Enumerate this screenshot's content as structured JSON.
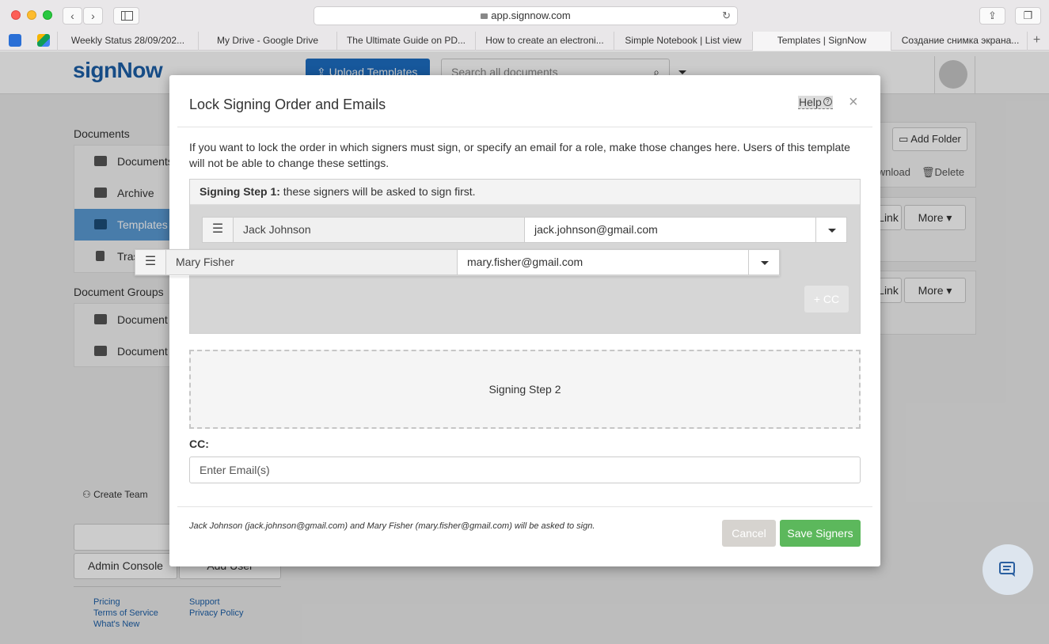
{
  "browser": {
    "url": "app.signnow.com",
    "tabs": [
      {
        "label": "Weekly Status 28/09/202...",
        "active": false
      },
      {
        "label": "My Drive - Google Drive",
        "active": false
      },
      {
        "label": "The Ultimate Guide on PD...",
        "active": false
      },
      {
        "label": "How to create an electroni...",
        "active": false
      },
      {
        "label": "Simple Notebook | List view",
        "active": false
      },
      {
        "label": "Templates | SignNow",
        "active": true
      },
      {
        "label": "Создание снимка экрана...",
        "active": false
      }
    ],
    "plus_label": "+"
  },
  "app": {
    "logo": "signNow",
    "upload_label": "Upload Templates",
    "search_placeholder": "Search all documents",
    "documents_heading": "Documents",
    "doc_items": [
      {
        "label": "Documents"
      },
      {
        "label": "Archive"
      },
      {
        "label": "Templates"
      },
      {
        "label": "Trash"
      }
    ],
    "groups_heading": "Document Groups",
    "group_items": [
      {
        "label": "Document Groups"
      },
      {
        "label": "Document Group Templates"
      }
    ],
    "add_folder_label": "Add Folder",
    "download_label": "Download",
    "delete_label": "Delete",
    "link_label": "Link",
    "more_label": "More",
    "create_team_label": "Create Team",
    "admin_console_label": "Admin Console",
    "add_user_label": "Add User",
    "footer": {
      "pricing": "Pricing",
      "terms": "Terms of Service",
      "whats_new": "What's New",
      "support": "Support",
      "privacy": "Privacy Policy"
    }
  },
  "modal": {
    "title": "Lock Signing Order and Emails",
    "help_label": "Help",
    "close_label": "×",
    "intro": "If you want to lock the order in which signers must sign, or specify an email for a role, make those changes here. Users of this template will not be able to change these settings.",
    "step1_heading": "Signing Step 1:",
    "step1_text": " these signers will be asked to sign first.",
    "signers": [
      {
        "role": "Jack Johnson",
        "email": "jack.johnson@gmail.com"
      },
      {
        "role": "Mary Fisher",
        "email": "mary.fisher@gmail.com"
      }
    ],
    "add_cc_label": "+ CC",
    "step2_label": "Signing Step 2",
    "cc_label": "CC:",
    "cc_placeholder": "Enter Email(s)",
    "summary": "Jack Johnson (jack.johnson@gmail.com) and Mary Fisher (mary.fisher@gmail.com) will be asked to sign.",
    "cancel_label": "Cancel",
    "save_label": "Save Signers"
  }
}
